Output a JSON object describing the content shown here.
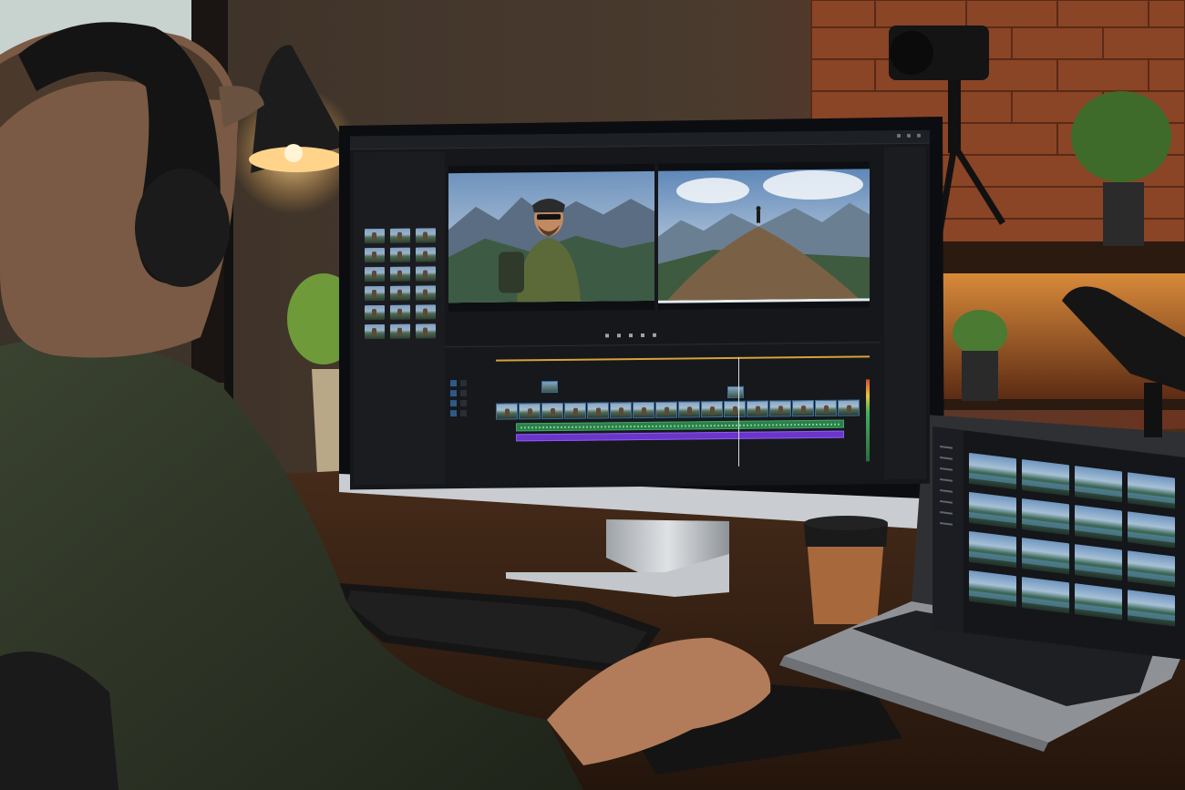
{
  "scene": {
    "description_free": true,
    "colors": {
      "wall_brick": "#7a3a22",
      "desk_wood": "#3a2415",
      "monitor_bezel": "#0c0d10",
      "editor_bg": "#15171b",
      "timeline_accent": "#d8a23a",
      "audio_track_green": "#2f7d4a",
      "audio_track_purple": "#6b35c9",
      "selection_blue": "#2e5a88",
      "lamp_glow": "#ffd48a",
      "cup_sleeve": "#a7683c"
    },
    "icons": [
      "window-close-icon",
      "window-minimize-icon",
      "play-icon",
      "step-forward-icon",
      "step-back-icon"
    ]
  },
  "monitor": {
    "viewer_timecode_left": "",
    "viewer_timecode_right": ""
  },
  "timeline": {
    "clip_count": 16,
    "audio_tracks": 2
  },
  "laptop": {
    "tile_count": 16
  }
}
